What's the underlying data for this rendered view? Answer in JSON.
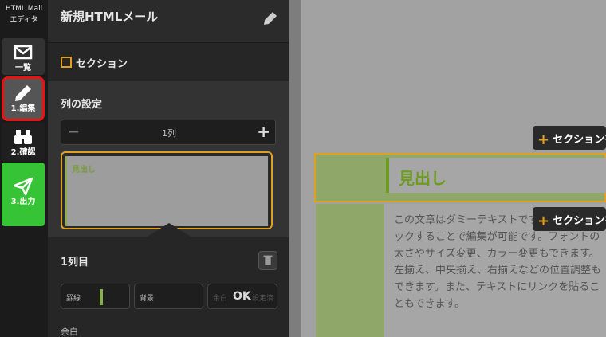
{
  "app": {
    "title_line1": "HTML Mail",
    "title_line2": "エディタ"
  },
  "nav": {
    "list_label": "一覧",
    "edit_label": "1.編集",
    "confirm_label": "2.確認",
    "output_label": "3.出力"
  },
  "panel": {
    "title": "新規HTMLメール",
    "section_label": "セクション",
    "col_settings_title": "列の設定",
    "col_count": "1列",
    "col_preview_label": "見出し",
    "col1_title": "1列目",
    "props": {
      "border": "罫線",
      "background": "背景",
      "margin": "余白",
      "margin_set": "設定済"
    },
    "ok_label": "OK",
    "margin_title": "余白"
  },
  "preview": {
    "heading": "見出し",
    "body_text": "この文章はダミーテキストです。ダブルクリックすることで編集が可能です。フォントの太さやサイズ変更、カラー変更もできます。左揃え、中央揃え、右揃えなどの位置調整もできます。また、テキストにリンクを貼ることもできます。",
    "add_section_label": "セクションを追加"
  },
  "colors": {
    "accent": "#e0a020",
    "green": "#6d9c1e",
    "output_green": "#36c436",
    "highlight_red": "#e11111"
  }
}
